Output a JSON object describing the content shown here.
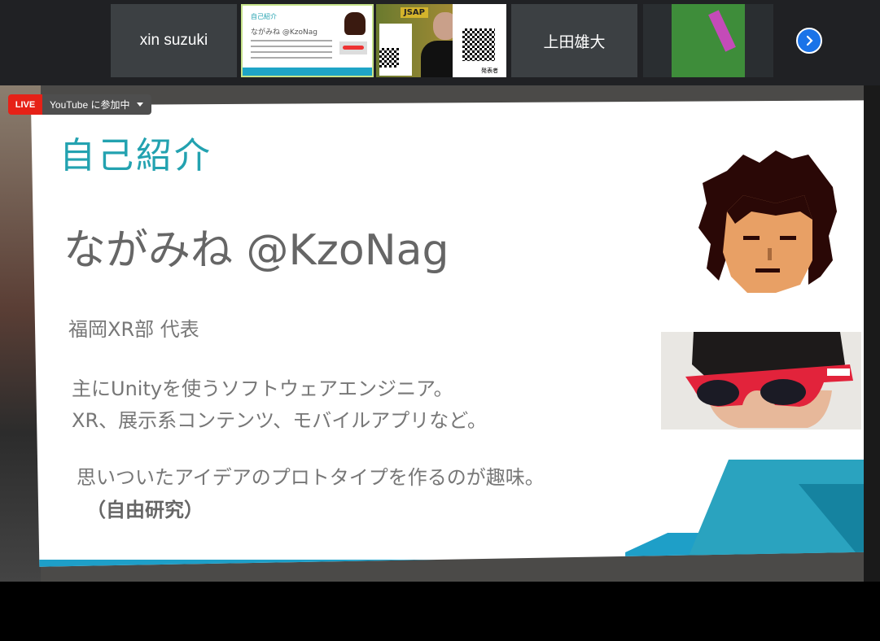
{
  "strip": {
    "participants": [
      {
        "name": "xin suzuki"
      },
      {
        "name": ""
      },
      {
        "name": ""
      },
      {
        "name": "上田雄大"
      },
      {
        "name": ""
      }
    ],
    "thumb_slide": {
      "title": "自己紹介",
      "name": "ながみね @KzoNag"
    },
    "thumb_presenter": {
      "badge": "JSAP",
      "label": "発表者"
    }
  },
  "live": {
    "badge": "LIVE",
    "youtube_label": "YouTube に参加中"
  },
  "slide": {
    "title": "自己紹介",
    "name": "ながみね @KzoNag",
    "role": "福岡XR部 代表",
    "desc_line1": "主にUnityを使うソフトウェアエンジニア。",
    "desc_line2": "XR、展示系コンテンツ、モバイルアプリなど。",
    "hobby": "思いついたアイデアのプロトタイプを作るのが趣味。",
    "hobby_note": "（自由研究）"
  },
  "colors": {
    "accent": "#23a2b0",
    "live_red": "#e62117",
    "next_blue": "#1a73e8"
  },
  "icons": {
    "next": "chevron-right-icon",
    "dropdown": "caret-down-icon"
  }
}
